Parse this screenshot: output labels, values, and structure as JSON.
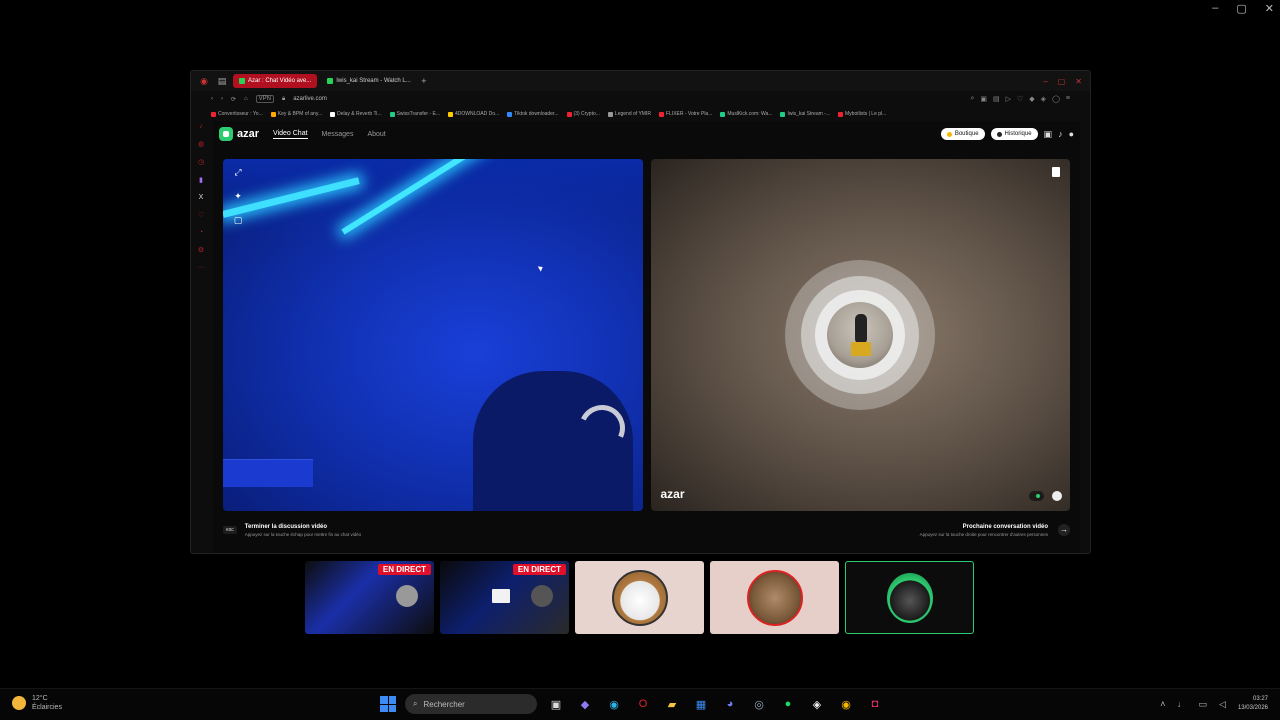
{
  "outer_window": {
    "controls": [
      "–",
      "▢",
      "✕"
    ]
  },
  "browser": {
    "tabs": [
      {
        "label": "Azar : Chat Vidéo ave...",
        "active": true
      },
      {
        "label": "Iwis_kai Stream - Watch L...",
        "active": false
      }
    ],
    "new_tab": "+",
    "url": "azarlive.com",
    "bookmarks": [
      {
        "label": "Convertisseur : Yo...",
        "color": "#e23"
      },
      {
        "label": "Key & BPM of any...",
        "color": "#fa0"
      },
      {
        "label": "Delay & Reverb Ti...",
        "color": "#fff"
      },
      {
        "label": "SwissTransfer - E...",
        "color": "#2c8"
      },
      {
        "label": "4DOWNLOAD Do...",
        "color": "#fc0"
      },
      {
        "label": "Tiktok downloader...",
        "color": "#38f"
      },
      {
        "label": "(3) Crypto...",
        "color": "#e23"
      },
      {
        "label": "Legend of YMIR",
        "color": "#999"
      },
      {
        "label": "FLIXER - Votre Pla...",
        "color": "#e23"
      },
      {
        "label": "MuslKick.com: Wa...",
        "color": "#2c8"
      },
      {
        "label": "Iwis_kai Stream -...",
        "color": "#2c8"
      },
      {
        "label": "Mybotlists | Le pl...",
        "color": "#e23"
      }
    ]
  },
  "azar": {
    "logo": "azar",
    "nav": [
      {
        "label": "Video Chat",
        "active": true
      },
      {
        "label": "Messages",
        "active": false
      },
      {
        "label": "About",
        "active": false
      }
    ],
    "boutique_label": "Boutique",
    "historique_label": "Historique",
    "partner_watermark": "azar",
    "partner_tag": "",
    "partner_chip": "",
    "footer": {
      "left_key": "esc",
      "left_title": "Terminer la discussion vidéo",
      "left_sub": "Appuyez sur la touche échap pour mettre fin au chat vidéo",
      "right_title": "Prochaine conversation vidéo",
      "right_sub": "Appuyez sur la touche droite pour rencontrer d'autres personnes",
      "right_arrow": "→"
    }
  },
  "switcher": {
    "live_label_1": "EN DIRECT",
    "live_label_2": "EN DIRECT"
  },
  "taskbar": {
    "weather_temp": "12°C",
    "weather_desc": "Éclaircies",
    "search_placeholder": "Rechercher",
    "time": "03:27",
    "date": "13/03/2026"
  }
}
